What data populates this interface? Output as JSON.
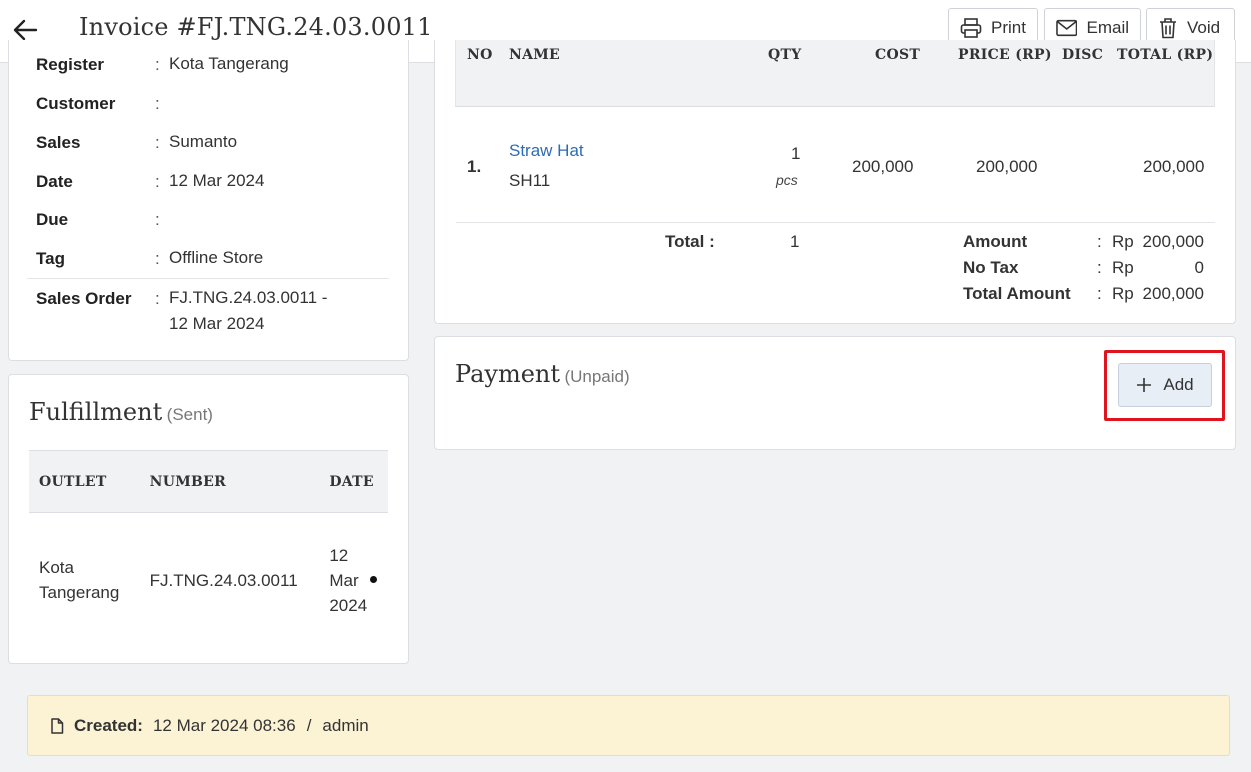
{
  "header": {
    "title": "Invoice #FJ.TNG.24.03.0011",
    "print_label": "Print",
    "email_label": "Email",
    "void_label": "Void"
  },
  "info": {
    "rows": [
      {
        "label": "Register",
        "value": "Kota Tangerang"
      },
      {
        "label": "Customer",
        "value": ""
      },
      {
        "label": "Sales",
        "value": "Sumanto"
      },
      {
        "label": "Date",
        "value": "12 Mar 2024"
      },
      {
        "label": "Due",
        "value": ""
      },
      {
        "label": "Tag",
        "value": "Offline Store"
      },
      {
        "label": "Sales Order",
        "value_line1": "FJ.TNG.24.03.0011 -",
        "value_line2": "12 Mar 2024"
      }
    ]
  },
  "items": {
    "headers": [
      "NO",
      "NAME",
      "QTY",
      "COST",
      "PRICE (RP)",
      "DISC",
      "TOTAL (RP)"
    ],
    "rows": [
      {
        "no": "1.",
        "name": "Straw Hat",
        "sku": "SH11",
        "qty": "1",
        "unit": "pcs",
        "cost": "200,000",
        "price": "200,000",
        "disc": "",
        "total": "200,000"
      }
    ],
    "total_label": "Total :",
    "total_qty": "1",
    "summary": [
      {
        "label": "Amount",
        "currency": "Rp",
        "value": "200,000"
      },
      {
        "label": "No Tax",
        "currency": "Rp",
        "value": "0"
      },
      {
        "label": "Total Amount",
        "currency": "Rp",
        "value": "200,000"
      }
    ]
  },
  "payment": {
    "title": "Payment",
    "status": "(Unpaid)",
    "add_label": "Add"
  },
  "fulfillment": {
    "title": "Fulfillment",
    "status": "(Sent)",
    "headers": [
      "OUTLET",
      "NUMBER",
      "DATE"
    ],
    "rows": [
      {
        "outlet": "Kota Tangerang",
        "number": "FJ.TNG.24.03.0011",
        "date": "12 Mar 2024"
      }
    ]
  },
  "footer": {
    "created_label": "Created:",
    "created_value": "12 Mar 2024 08:36",
    "separator": "/",
    "created_by": "admin"
  }
}
